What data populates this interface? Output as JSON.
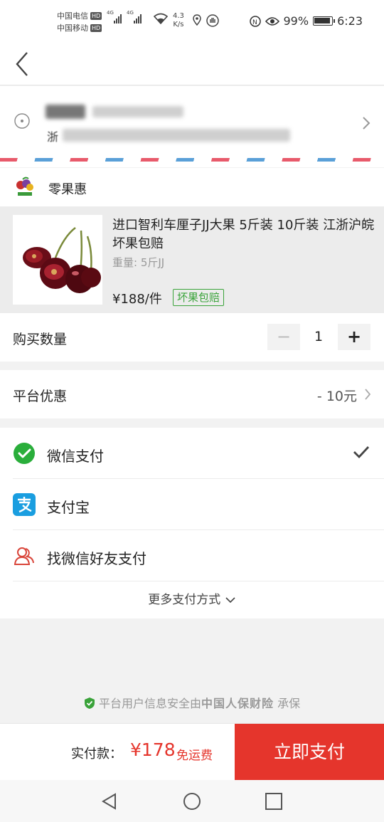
{
  "status_bar": {
    "carrier1": "中国电信",
    "carrier2": "中国移动",
    "hd": "HD",
    "net1": "4G",
    "net2": "4G",
    "speed_value": "4.3",
    "speed_unit": "K/s",
    "battery": "99%",
    "time": "6:23",
    "icons": [
      "wifi-icon",
      "location-icon",
      "glove-icon",
      "nfc-icon",
      "eye-icon",
      "battery-icon"
    ]
  },
  "nav": {
    "back_icon": "chevron-left-icon"
  },
  "address": {
    "prefix": "浙",
    "icon": "location-pin-icon",
    "arrow_icon": "chevron-right-icon"
  },
  "shop": {
    "name": "零果惠",
    "logo_icon": "shop-logo-icon"
  },
  "product": {
    "title": "进口智利车厘子JJ大果 5斤装 10斤装 江浙沪皖坏果包赔",
    "spec": "重量: 5斤JJ",
    "price": "¥188/件",
    "badge": "坏果包赔",
    "image_icon": "cherries-image"
  },
  "quantity": {
    "label": "购买数量",
    "minus": "−",
    "value": "1",
    "plus": "+"
  },
  "promo": {
    "label": "平台优惠",
    "value": "- 10元"
  },
  "payment": {
    "methods": [
      {
        "label": "微信支付",
        "icon": "wechat-pay-icon",
        "selected": true
      },
      {
        "label": "支付宝",
        "icon": "alipay-icon",
        "selected": false
      },
      {
        "label": "找微信好友支付",
        "icon": "friends-icon",
        "selected": false
      }
    ],
    "more": "更多支付方式"
  },
  "security": {
    "prefix": "平台用户信息安全由",
    "insurer": "中国人保财险",
    "suffix": "承保"
  },
  "footer": {
    "total_label": "实付款：",
    "total_amount": "¥178",
    "shipping": "免运费",
    "pay_button": "立即支付"
  },
  "colors": {
    "accent": "#e5352c",
    "green_badge": "#3aa33a",
    "wechat": "#2aae3b",
    "alipay": "#1a9ee0"
  }
}
